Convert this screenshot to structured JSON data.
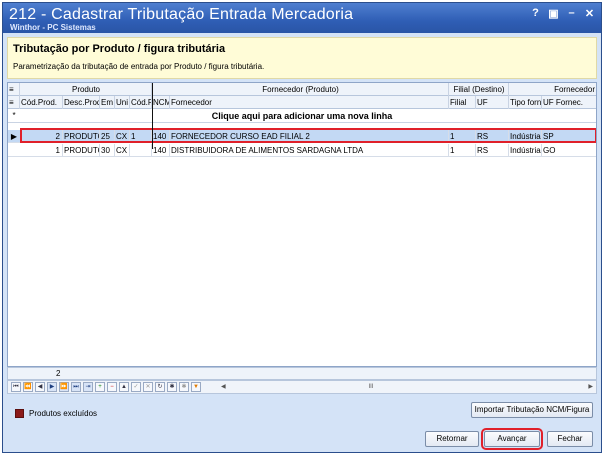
{
  "window": {
    "title": "212 - Cadastrar Tributação Entrada Mercadoria",
    "subtitle": "Winthor - PC Sistemas",
    "controls": [
      "?",
      "▣",
      "–",
      "✕"
    ]
  },
  "header": {
    "title": "Tributação por Produto / figura tributária",
    "description": "Parametrização da tributação de entrada por Produto / figura tributária."
  },
  "grid": {
    "group_headers": [
      "Produto",
      "Fornecedor (Produto)",
      "Filial (Destino)",
      "Fornecedor"
    ],
    "columns": [
      "Cód.Prod.",
      "Desc.Prod",
      "Em",
      "Uni",
      "Cód.Fi",
      "NCM",
      "Fornecedor",
      "Filial",
      "UF",
      "Tipo forn",
      "UF Fornec."
    ],
    "add_row_text": "Clique aqui para adicionar uma nova linha",
    "rows": [
      [
        "2",
        "PRODUTO",
        "25",
        "CX",
        "1",
        "140",
        "FORNECEDOR CURSO EAD FILIAL 2",
        "1",
        "RS",
        "Indústria",
        "SP"
      ],
      [
        "1",
        "PRODUTO",
        "30",
        "CX",
        "",
        "140",
        "DISTRIBUIDORA DE ALIMENTOS SARDAGNA LTDA",
        "1",
        "RS",
        "Indústria",
        "GO"
      ]
    ],
    "footer_count": "2",
    "scroll_label": "III"
  },
  "legend": {
    "label": "Produtos excluídos",
    "color": "#8b1a1a"
  },
  "buttons": {
    "import": "Importar Tributação NCM/Figura",
    "back": "Retornar",
    "next": "Avançar",
    "close": "Fechar"
  },
  "accent": {
    "highlight": "#e0202a",
    "title_bg": "#2f5eb5"
  }
}
